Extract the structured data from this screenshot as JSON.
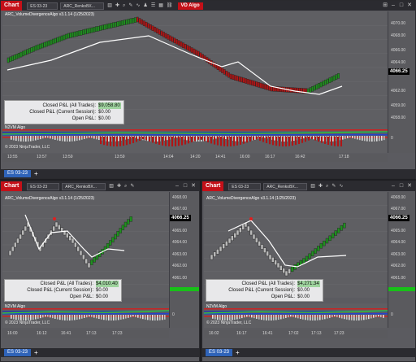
{
  "windows": [
    {
      "id": "top",
      "chart_label": "Chart",
      "instrument": "ES 03-23",
      "bar_type": "ARC_RenkoBX...",
      "badge": "VD Algo",
      "indicator_title": "ARC_VolumeDivergenceAlgo v3.1.14 (1/25/2023)",
      "price_ticks": [
        "4070.00",
        "4068.00",
        "4066.00",
        "4064.00",
        "4062.00",
        "4059.00",
        "4058.00",
        "4056.00",
        "4054.00"
      ],
      "current_price": "4066.25",
      "x_ticks": [
        "13:55",
        "13:57",
        "13:59",
        "13:59",
        "14:04",
        "14:20",
        "14:41",
        "16:00",
        "16:17",
        "16:42",
        "17:18"
      ],
      "pnl": {
        "all_label": "Closed P&L (All Trades):",
        "all_value": "$9,058.80",
        "session_label": "Closed P&L (Current Session):",
        "session_value": "$0.00",
        "open_label": "Open P&L:",
        "open_value": "$0.00"
      },
      "sub_indicator": "N2VM Algo",
      "sub_tick": "0",
      "copyright": "© 2023 NinjaTrader, LLC",
      "bottom_tab": "ES 03-23",
      "add_tab": "+"
    },
    {
      "id": "bottom-left",
      "chart_label": "Chart",
      "instrument": "ES 03-23",
      "bar_type": "ARC_RenkoBX...",
      "indicator_title": "ARC_VolumeDivergenceAlgo v3.1.14 (1/25/2023)",
      "price_ticks": [
        "4068.00",
        "4067.00",
        "4066.00",
        "4065.00",
        "4064.00",
        "4063.00",
        "4062.00",
        "4061.00"
      ],
      "current_price": "4066.25",
      "x_ticks": [
        "16:00",
        "16:12",
        "16:41",
        "17:13",
        "17:23"
      ],
      "pnl": {
        "all_label": "Closed P&L (All Trades):",
        "all_value": "$4,010.40",
        "session_label": "Closed P&L (Current Session):",
        "session_value": "$0.00",
        "open_label": "Open P&L:",
        "open_value": "$0.00"
      },
      "sub_indicator": "N2VM Algo",
      "sub_tick": "0",
      "copyright": "© 2023 NinjaTrader, LLC",
      "bottom_tab": "ES 03-23",
      "add_tab": "+"
    },
    {
      "id": "bottom-right",
      "chart_label": "Chart",
      "instrument": "ES 03-23",
      "bar_type": "ARC_RenkoBX...",
      "indicator_title": "ARC_VolumeDivergenceAlgo v3.1.14 (1/25/2023)",
      "price_ticks": [
        "4068.00",
        "4067.00",
        "4066.00",
        "4065.00",
        "4064.00",
        "4063.00",
        "4062.00",
        "4061.00"
      ],
      "current_price": "4066.25",
      "x_ticks": [
        "16:02",
        "16:17",
        "16:41",
        "17:02",
        "17:13",
        "17:23"
      ],
      "pnl": {
        "all_label": "Closed P&L (All Trades):",
        "all_value": "$4,271.34",
        "session_label": "Closed P&L (Current Session):",
        "session_value": "$0.00",
        "open_label": "Open P&L:",
        "open_value": "$0.00"
      },
      "sub_indicator": "N2VM Algo",
      "sub_tick": "0",
      "copyright": "© 2023 NinjaTrader, LLC",
      "bottom_tab": "ES 03-23",
      "add_tab": "+"
    }
  ],
  "toolbar_icons": [
    "bars-icon",
    "crosshair-icon",
    "zoom-icon",
    "draw-icon",
    "indicators-icon",
    "strategies-icon",
    "properties-icon"
  ],
  "colors": {
    "chart_tab": "#c41018",
    "bull_candle": "#1f8f1f",
    "bear_candle": "#b01515",
    "neutral_candle": "#b8b8b8",
    "trail_line": "#ffffff",
    "highlight_value": "#9fd49f",
    "bottom_tab": "#2f63b8"
  }
}
